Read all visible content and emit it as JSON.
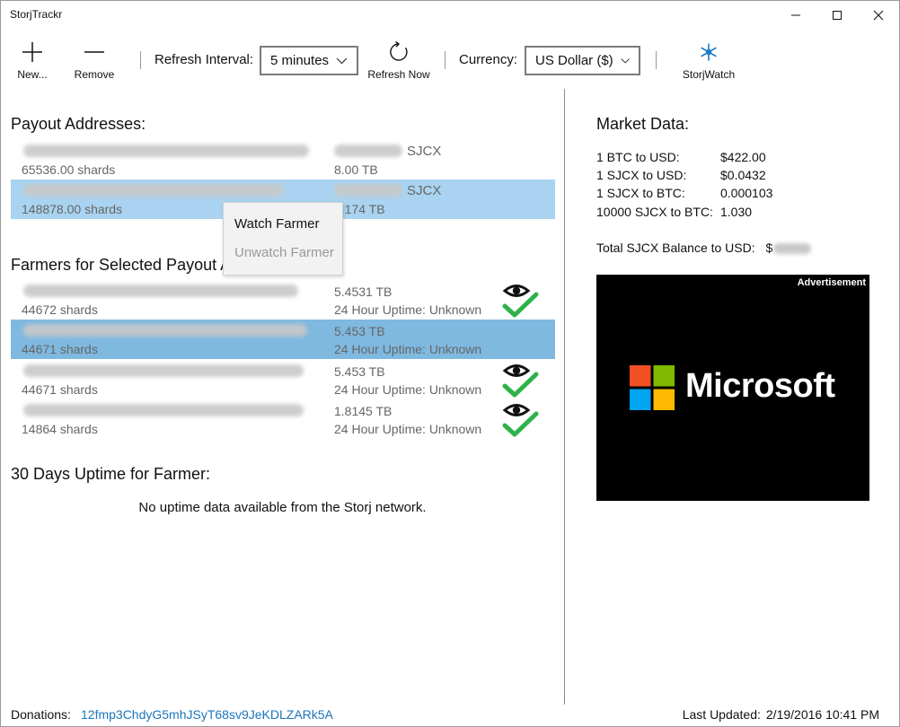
{
  "window": {
    "title": "StorjTrackr"
  },
  "toolbar": {
    "new_label": "New...",
    "remove_label": "Remove",
    "refresh_interval_label": "Refresh Interval:",
    "refresh_interval_value": "5 minutes",
    "refresh_now_label": "Refresh Now",
    "currency_label": "Currency:",
    "currency_value": "US Dollar ($)",
    "storjwatch_label": "StorjWatch",
    "icons": [
      "plus-icon",
      "minus-icon",
      "chevron-down-icon",
      "refresh-icon",
      "snowflake-icon"
    ]
  },
  "payout": {
    "title": "Payout Addresses:",
    "rows": [
      {
        "unit": "SJCX",
        "shards": "65536.00 shards",
        "size": "8.00 TB"
      },
      {
        "unit": "SJCX",
        "shards": "148878.00 shards",
        "size": "8.174 TB"
      }
    ]
  },
  "context_menu": {
    "watch": "Watch Farmer",
    "unwatch": "Unwatch Farmer"
  },
  "farmers": {
    "title": "Farmers for Selected Payout A",
    "rows": [
      {
        "size": "5.4531 TB",
        "shards": "44672 shards",
        "uptime": "24 Hour Uptime: Unknown",
        "watched": true
      },
      {
        "size": "5.453 TB",
        "shards": "44671 shards",
        "uptime": "24 Hour Uptime: Unknown",
        "watched": false
      },
      {
        "size": "5.453 TB",
        "shards": "44671 shards",
        "uptime": "24 Hour Uptime: Unknown",
        "watched": true
      },
      {
        "size": "1.8145 TB",
        "shards": "14864 shards",
        "uptime": "24 Hour Uptime: Unknown",
        "watched": true
      }
    ]
  },
  "uptime": {
    "title": "30 Days Uptime for Farmer:",
    "empty_message": "No uptime data available from the Storj network."
  },
  "market": {
    "title": "Market Data:",
    "rows": [
      {
        "label": "1 BTC to USD:",
        "value": "$422.00"
      },
      {
        "label": "1 SJCX to USD:",
        "value": "$0.0432"
      },
      {
        "label": "1 SJCX to BTC:",
        "value": "0.000103"
      },
      {
        "label": "10000 SJCX to BTC:",
        "value": "1.030"
      }
    ],
    "balance_label": "Total SJCX Balance to USD:",
    "balance_prefix": "$"
  },
  "ad": {
    "label": "Advertisement",
    "brand": "Microsoft",
    "colors": [
      "#f25022",
      "#7fba00",
      "#00a4ef",
      "#ffb900"
    ]
  },
  "footer": {
    "donations_label": "Donations:",
    "donations_address": "12fmp3ChdyG5mhJSyT68sv9JeKDLZARk5A",
    "last_updated_label": "Last Updated:",
    "last_updated_value": "2/19/2016 10:41 PM"
  },
  "colors": {
    "selection_light": "#a9d3f0",
    "selection_dark": "#7fb9e0",
    "check_green": "#2db24a",
    "link": "#1b75bc",
    "storjwatch_blue": "#1f7bc9"
  }
}
